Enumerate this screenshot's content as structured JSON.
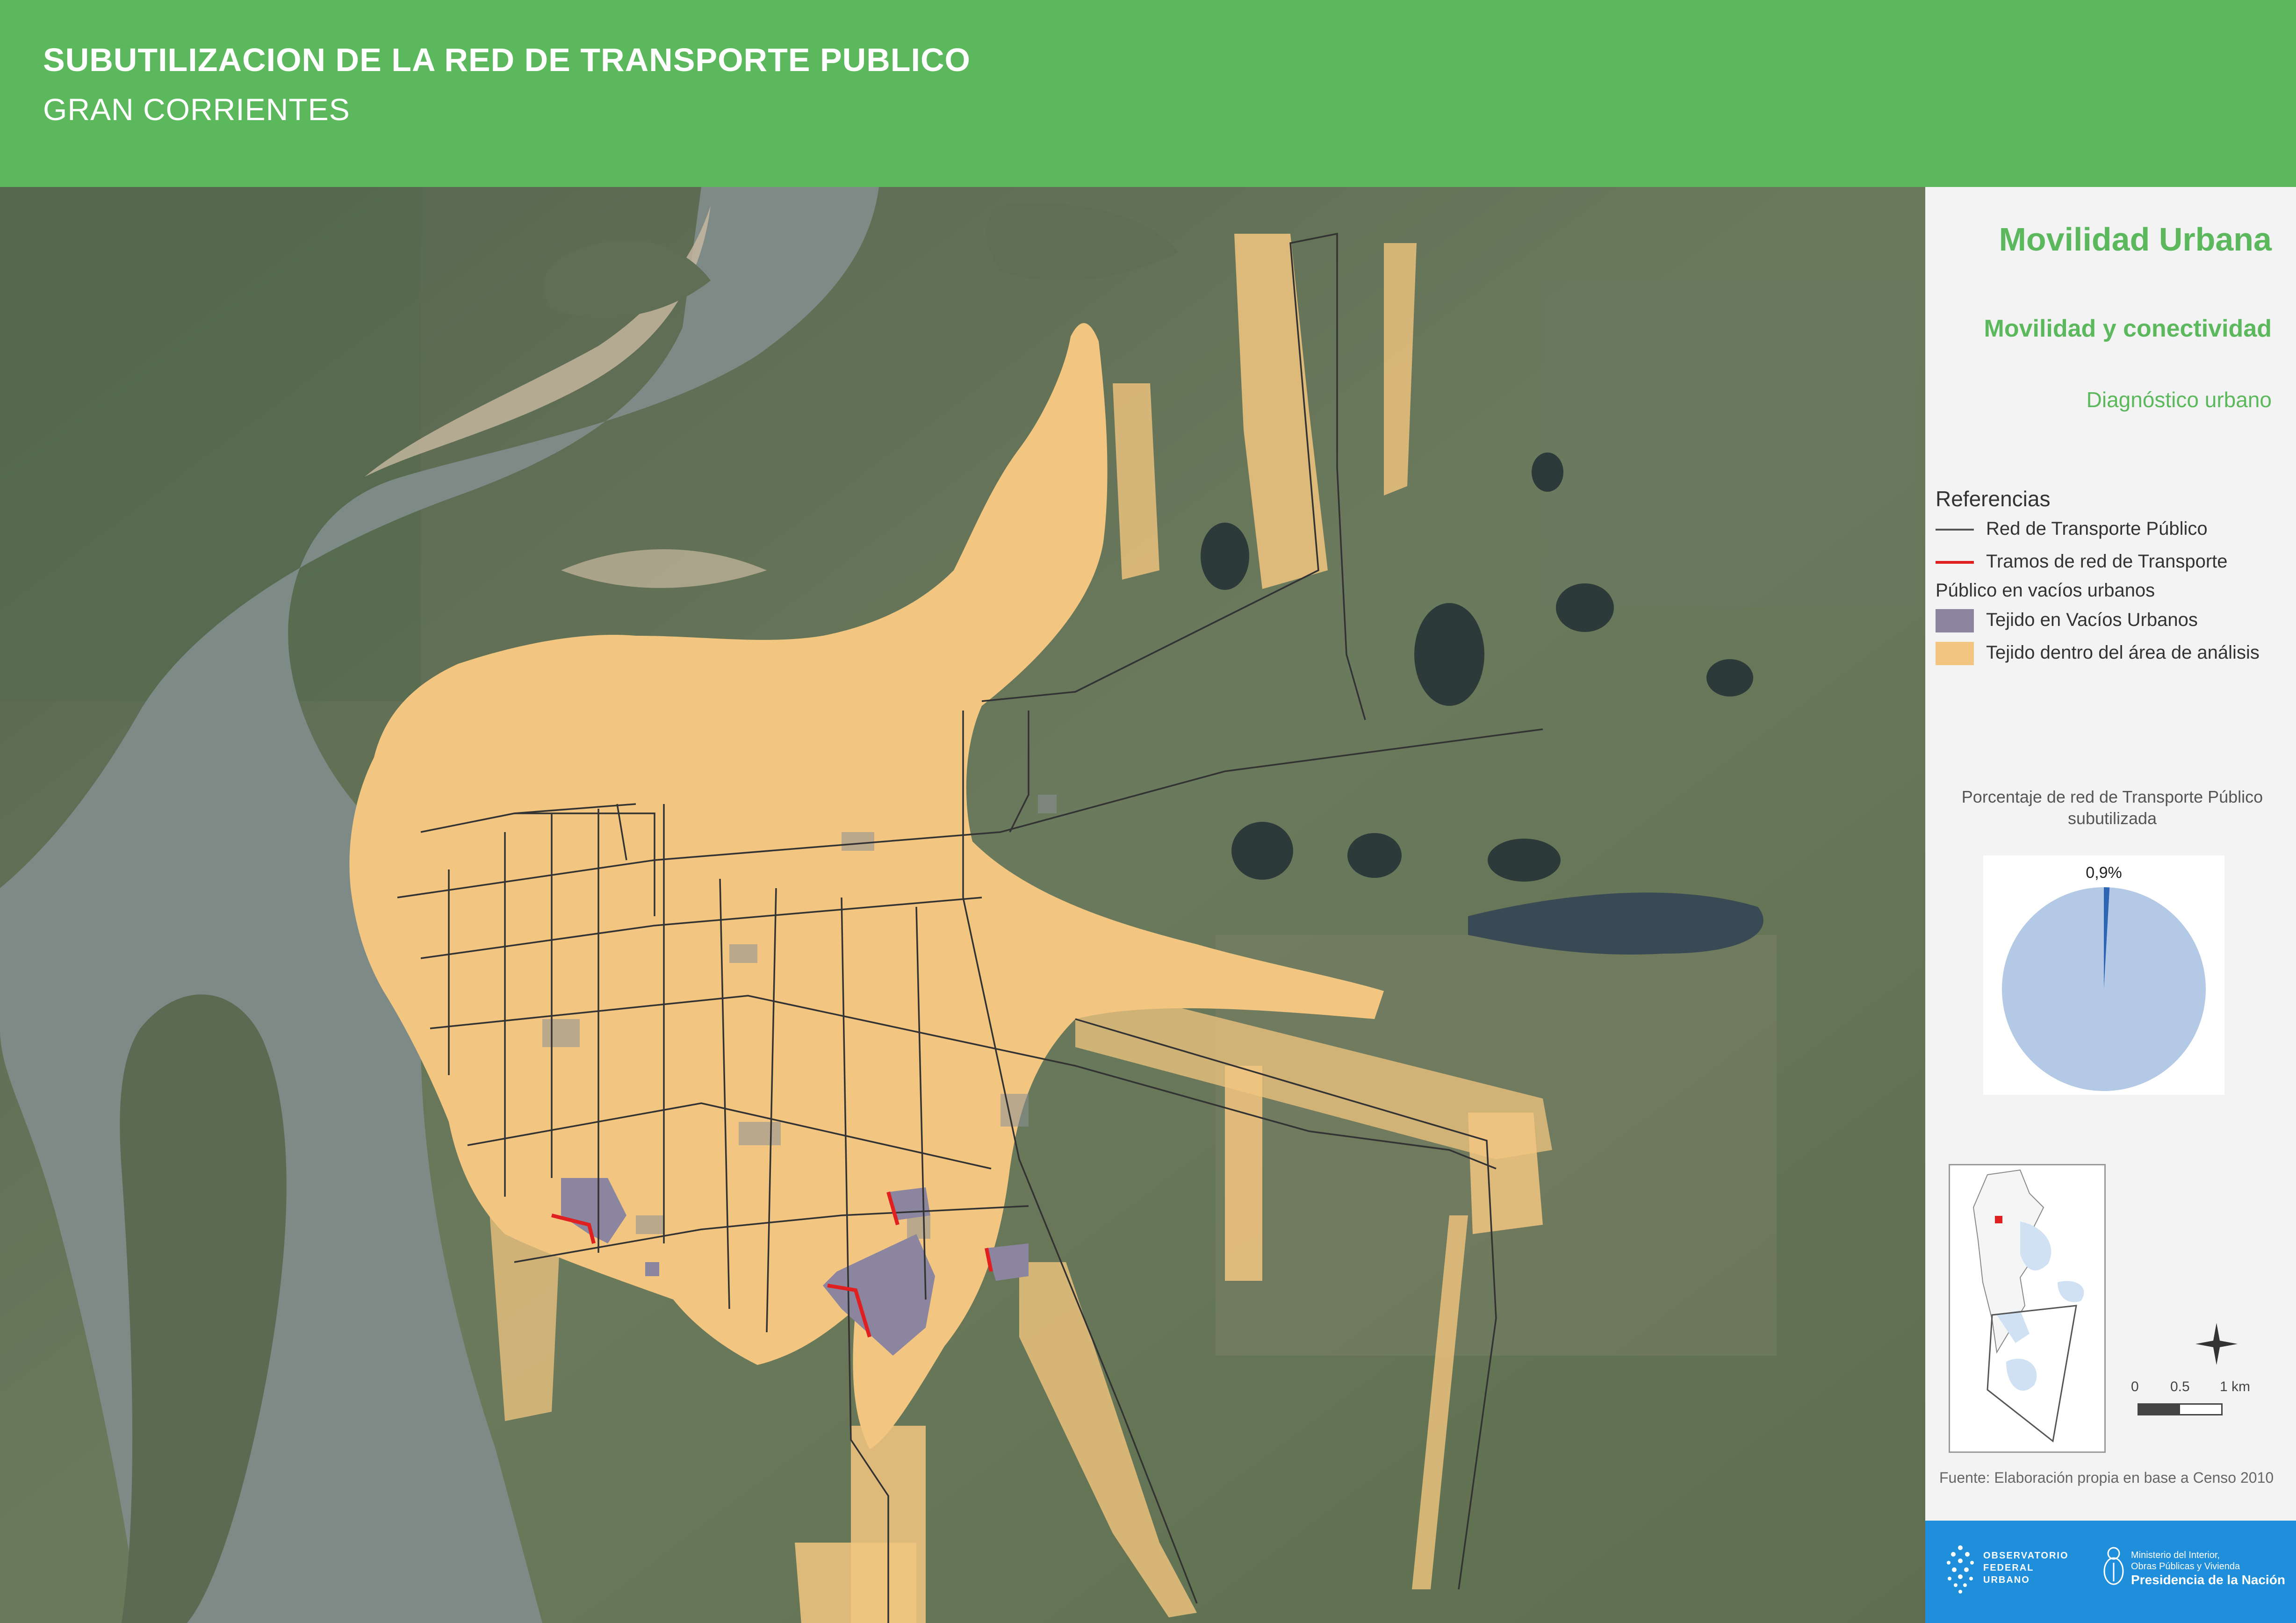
{
  "header": {
    "title": "SUBUTILIZACION DE LA RED DE TRANSPORTE PUBLICO",
    "subtitle": "GRAN CORRIENTES"
  },
  "panel": {
    "title": "Movilidad Urbana",
    "subtitle": "Movilidad y conectividad",
    "diagnostic": "Diagnóstico urbano",
    "references_title": "Referencias",
    "references": [
      {
        "label": "Red de Transporte Público",
        "color": "#555555"
      },
      {
        "label": "Tramos de red de Transporte Público en vacíos urbanos",
        "color": "#e02020"
      },
      {
        "label": "Tejido en Vacíos Urbanos",
        "color": "#8b85a0"
      },
      {
        "label": "Tejido dentro del área de análisis",
        "color": "#f2c680"
      }
    ],
    "pie_caption": "Porcentaje de red de Transporte Público subutilizada",
    "pie_label": "0,9%",
    "scale": {
      "labels": [
        "0",
        "0.5",
        "1 km"
      ]
    },
    "source": "Fuente: Elaboración propia en base a Censo 2010"
  },
  "footer": {
    "observatorio": [
      "OBSERVATORIO",
      "FEDERAL",
      "URBANO"
    ],
    "ministerio_line1": "Ministerio del Interior,",
    "ministerio_line2": "Obras Públicas y Vivienda",
    "presidencia": "Presidencia de la Nación"
  },
  "colors": {
    "header_green": "#5cb85c",
    "urban_fabric": "#f2c680",
    "vacant_fabric": "#8b85a0",
    "network": "#333333",
    "underused_network": "#e02020",
    "pie_main": "#b3c9e6",
    "pie_slice": "#2e66b3",
    "footer_blue": "#1f8fdc"
  },
  "chart_data": {
    "type": "pie",
    "title": "Porcentaje de red de Transporte Público subutilizada",
    "slices": [
      {
        "label": "0,9%",
        "value": 0.9,
        "color": "#2e66b3"
      },
      {
        "label": "",
        "value": 99.1,
        "color": "#b3c9e6"
      }
    ]
  }
}
